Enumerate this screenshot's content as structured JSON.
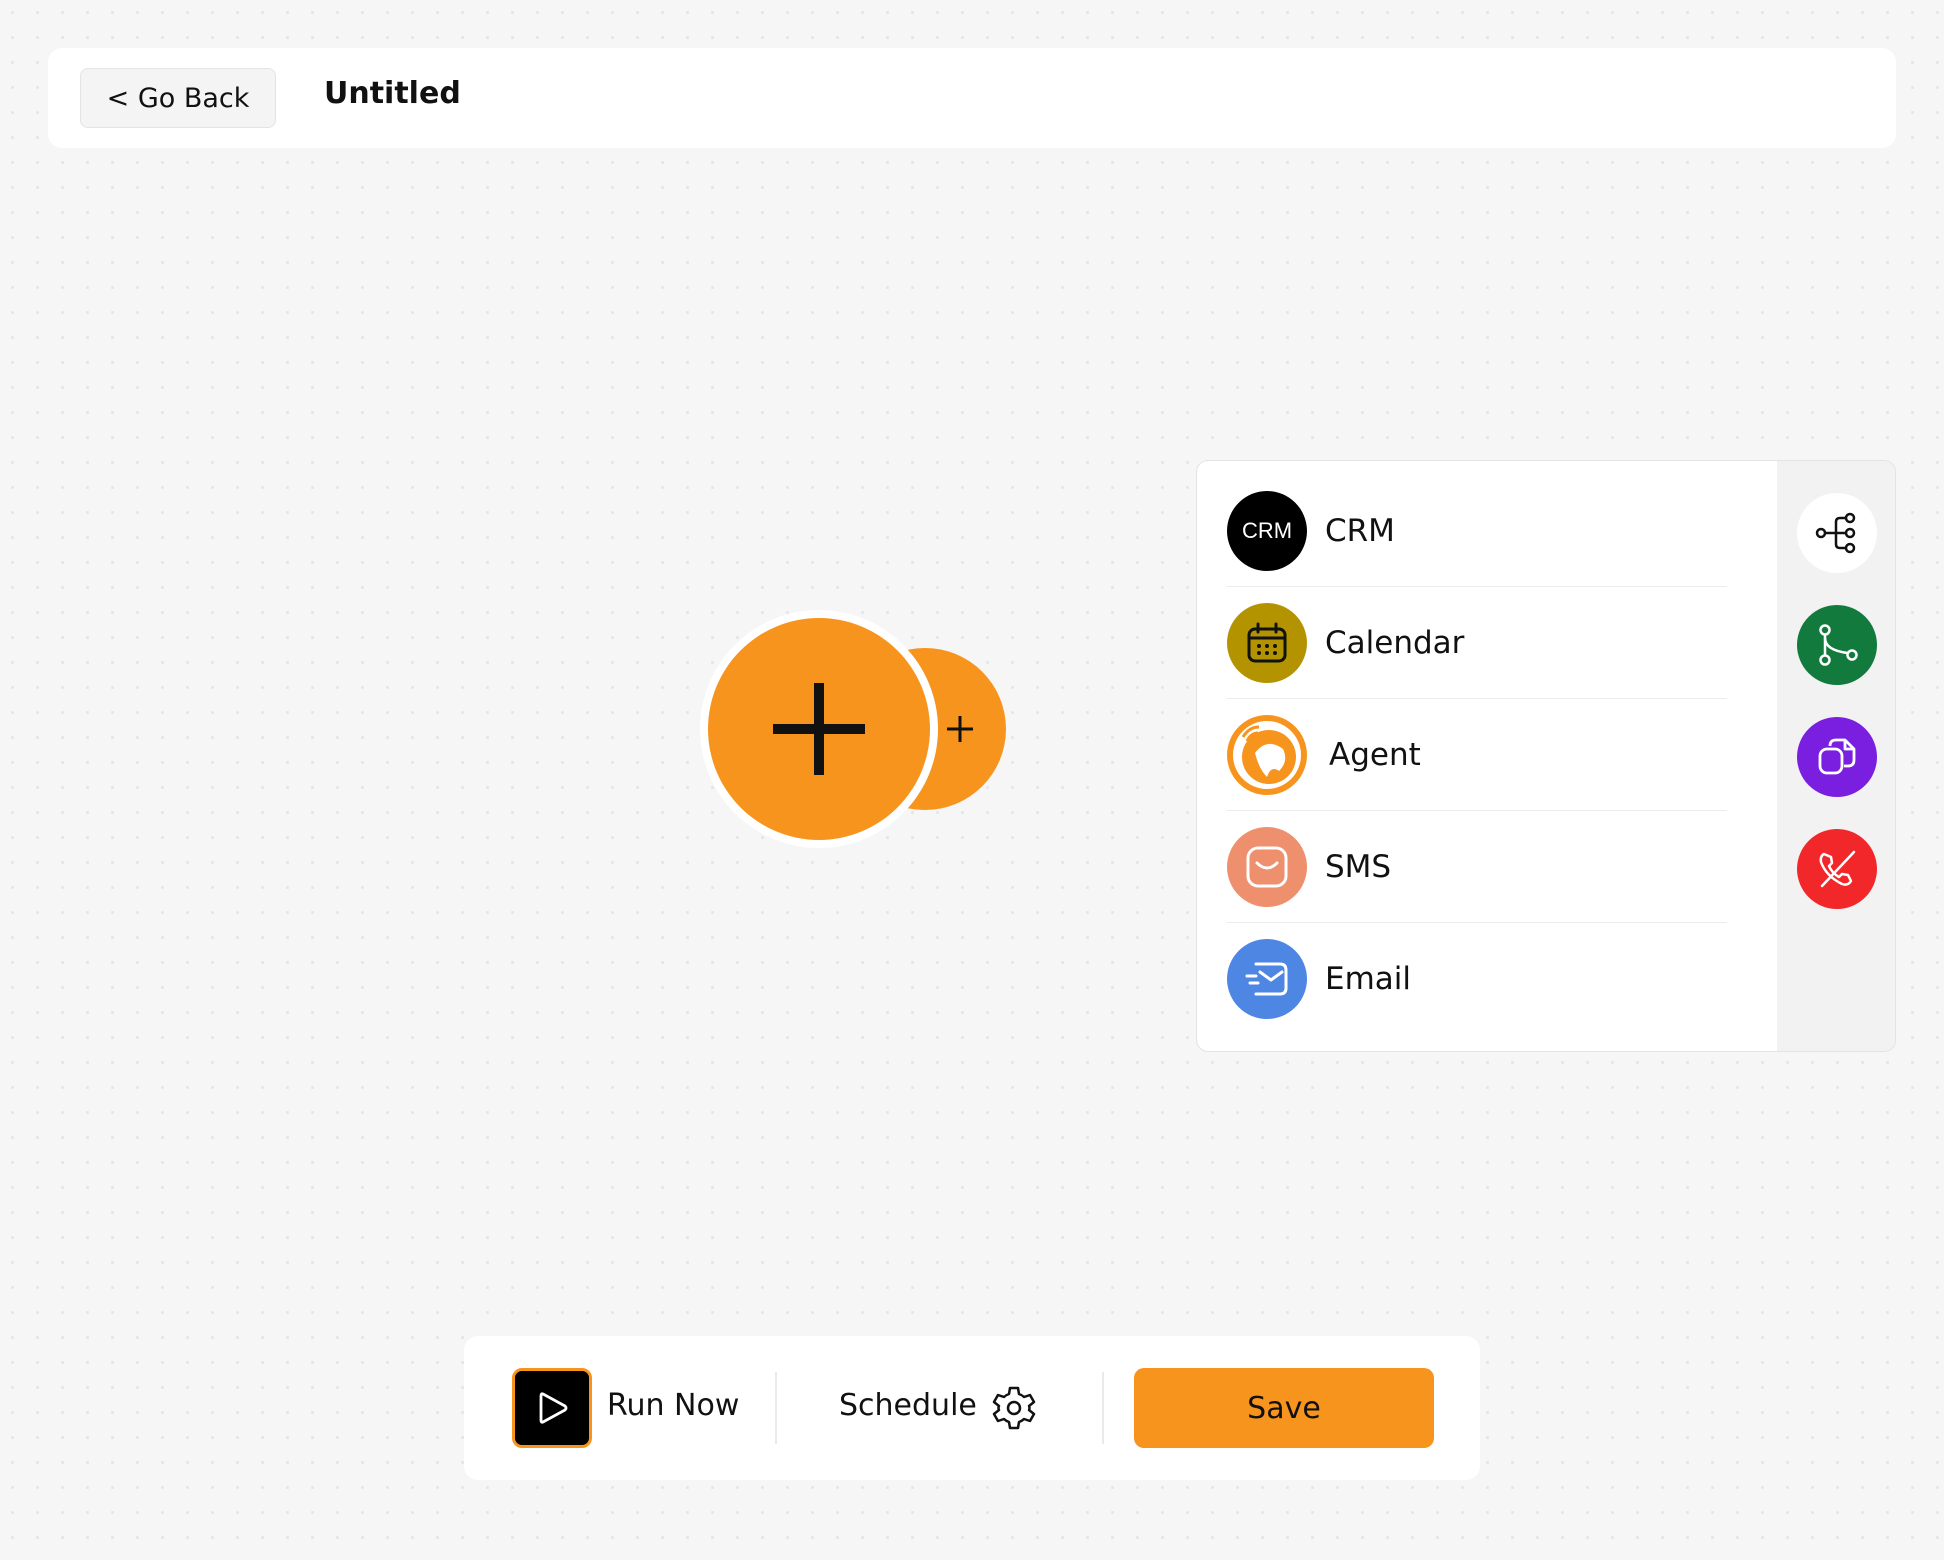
{
  "header": {
    "back_label": "< Go Back",
    "title": "Untitled"
  },
  "colors": {
    "accent": "#f7941d",
    "canvas": "#f6f6f6",
    "crm": "#000000",
    "calendar": "#b39400",
    "agent": "#f7941d",
    "sms": "#ee8f6e",
    "email": "#4e86e4",
    "split": "#137a3e",
    "copy": "#7a1fe0",
    "hangup": "#f2272a"
  },
  "canvas": {
    "main_node_icon": "plus-icon",
    "secondary_node_icon": "plus-icon"
  },
  "panel": {
    "items": [
      {
        "label": "CRM",
        "badge": "CRM",
        "icon": "crm-icon"
      },
      {
        "label": "Calendar",
        "icon": "calendar-icon"
      },
      {
        "label": "Agent",
        "icon": "agent-icon"
      },
      {
        "label": "SMS",
        "icon": "sms-icon"
      },
      {
        "label": "Email",
        "icon": "email-icon"
      }
    ],
    "side_actions": [
      {
        "icon": "flow-tree-icon"
      },
      {
        "icon": "branch-icon"
      },
      {
        "icon": "copy-icon"
      },
      {
        "icon": "hang-up-icon"
      }
    ]
  },
  "toolbar": {
    "run_label": "Run Now",
    "schedule_label": "Schedule",
    "save_label": "Save"
  }
}
